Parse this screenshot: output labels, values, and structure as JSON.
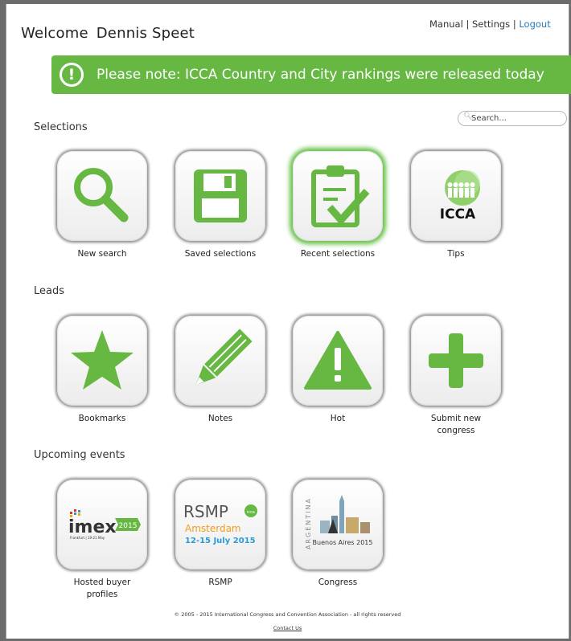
{
  "header": {
    "welcome": "Welcome",
    "user_name": "Dennis Speet",
    "links": {
      "manual": "Manual",
      "settings": "Settings",
      "logout": "Logout",
      "sep": "|"
    }
  },
  "banner": {
    "icon": "exclamation-circle-icon",
    "text": "Please note: ICCA Country and City rankings were released today",
    "color": "#66b843"
  },
  "search": {
    "placeholder": "Search...",
    "value": ""
  },
  "sections": {
    "selections": {
      "title": "Selections",
      "items": [
        {
          "label": "New search",
          "icon": "magnifier-icon"
        },
        {
          "label": "Saved selections",
          "icon": "floppy-disk-icon"
        },
        {
          "label": "Recent selections",
          "icon": "clipboard-check-icon",
          "active": true
        },
        {
          "label": "Tips",
          "icon": "icca-logo"
        }
      ]
    },
    "leads": {
      "title": "Leads",
      "items": [
        {
          "label": "Bookmarks",
          "icon": "star-icon"
        },
        {
          "label": "Notes",
          "icon": "pencil-icon"
        },
        {
          "label": "Hot",
          "icon": "warning-triangle-icon"
        },
        {
          "label": "Submit new congress",
          "icon": "plus-icon"
        }
      ]
    },
    "events": {
      "title": "Upcoming events",
      "items": [
        {
          "label": "Hosted buyer profiles",
          "logo": {
            "brand": "imex",
            "year": "2015",
            "sub": "Frankfurt | 19-21 May"
          }
        },
        {
          "label": "RSMP",
          "logo": {
            "brand": "RSMP",
            "city": "Amsterdam",
            "dates": "12-15 July 2015",
            "badge": "icca"
          }
        },
        {
          "label": "Congress",
          "logo": {
            "country": "ARGENTINA",
            "city": "Buenos Aires 2015"
          }
        }
      ]
    }
  },
  "footer": {
    "copyright": "© 2005 - 2015 International Congress and Convention Association - all rights reserved",
    "contact": "Contact Us"
  },
  "colors": {
    "accent_green": "#66b843",
    "link_blue": "#2a7ab8"
  }
}
